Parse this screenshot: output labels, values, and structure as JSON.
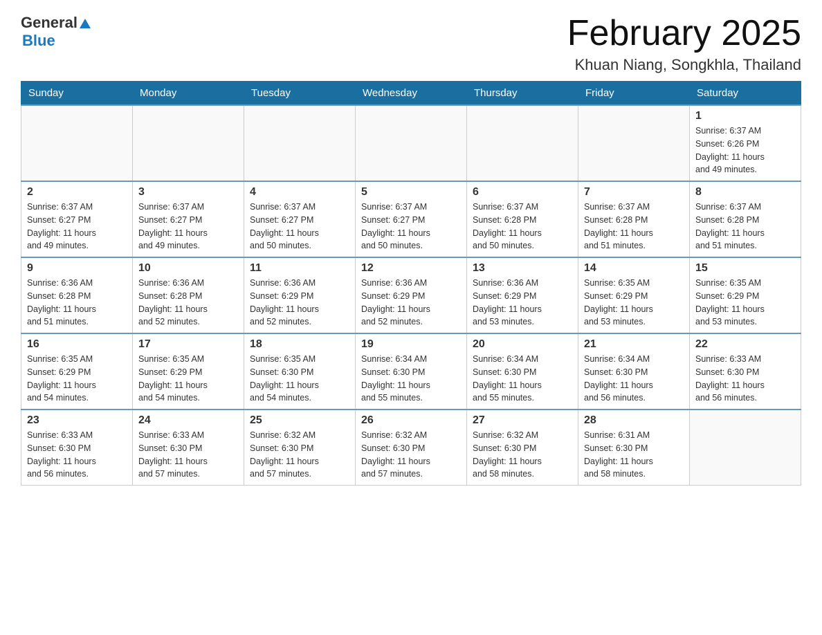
{
  "header": {
    "logo": {
      "general": "General",
      "arrow": "▲",
      "blue": "Blue"
    },
    "title": "February 2025",
    "location": "Khuan Niang, Songkhla, Thailand"
  },
  "calendar": {
    "days_of_week": [
      "Sunday",
      "Monday",
      "Tuesday",
      "Wednesday",
      "Thursday",
      "Friday",
      "Saturday"
    ],
    "weeks": [
      {
        "days": [
          {
            "date": "",
            "info": ""
          },
          {
            "date": "",
            "info": ""
          },
          {
            "date": "",
            "info": ""
          },
          {
            "date": "",
            "info": ""
          },
          {
            "date": "",
            "info": ""
          },
          {
            "date": "",
            "info": ""
          },
          {
            "date": "1",
            "info": "Sunrise: 6:37 AM\nSunset: 6:26 PM\nDaylight: 11 hours\nand 49 minutes."
          }
        ]
      },
      {
        "days": [
          {
            "date": "2",
            "info": "Sunrise: 6:37 AM\nSunset: 6:27 PM\nDaylight: 11 hours\nand 49 minutes."
          },
          {
            "date": "3",
            "info": "Sunrise: 6:37 AM\nSunset: 6:27 PM\nDaylight: 11 hours\nand 49 minutes."
          },
          {
            "date": "4",
            "info": "Sunrise: 6:37 AM\nSunset: 6:27 PM\nDaylight: 11 hours\nand 50 minutes."
          },
          {
            "date": "5",
            "info": "Sunrise: 6:37 AM\nSunset: 6:27 PM\nDaylight: 11 hours\nand 50 minutes."
          },
          {
            "date": "6",
            "info": "Sunrise: 6:37 AM\nSunset: 6:28 PM\nDaylight: 11 hours\nand 50 minutes."
          },
          {
            "date": "7",
            "info": "Sunrise: 6:37 AM\nSunset: 6:28 PM\nDaylight: 11 hours\nand 51 minutes."
          },
          {
            "date": "8",
            "info": "Sunrise: 6:37 AM\nSunset: 6:28 PM\nDaylight: 11 hours\nand 51 minutes."
          }
        ]
      },
      {
        "days": [
          {
            "date": "9",
            "info": "Sunrise: 6:36 AM\nSunset: 6:28 PM\nDaylight: 11 hours\nand 51 minutes."
          },
          {
            "date": "10",
            "info": "Sunrise: 6:36 AM\nSunset: 6:28 PM\nDaylight: 11 hours\nand 52 minutes."
          },
          {
            "date": "11",
            "info": "Sunrise: 6:36 AM\nSunset: 6:29 PM\nDaylight: 11 hours\nand 52 minutes."
          },
          {
            "date": "12",
            "info": "Sunrise: 6:36 AM\nSunset: 6:29 PM\nDaylight: 11 hours\nand 52 minutes."
          },
          {
            "date": "13",
            "info": "Sunrise: 6:36 AM\nSunset: 6:29 PM\nDaylight: 11 hours\nand 53 minutes."
          },
          {
            "date": "14",
            "info": "Sunrise: 6:35 AM\nSunset: 6:29 PM\nDaylight: 11 hours\nand 53 minutes."
          },
          {
            "date": "15",
            "info": "Sunrise: 6:35 AM\nSunset: 6:29 PM\nDaylight: 11 hours\nand 53 minutes."
          }
        ]
      },
      {
        "days": [
          {
            "date": "16",
            "info": "Sunrise: 6:35 AM\nSunset: 6:29 PM\nDaylight: 11 hours\nand 54 minutes."
          },
          {
            "date": "17",
            "info": "Sunrise: 6:35 AM\nSunset: 6:29 PM\nDaylight: 11 hours\nand 54 minutes."
          },
          {
            "date": "18",
            "info": "Sunrise: 6:35 AM\nSunset: 6:30 PM\nDaylight: 11 hours\nand 54 minutes."
          },
          {
            "date": "19",
            "info": "Sunrise: 6:34 AM\nSunset: 6:30 PM\nDaylight: 11 hours\nand 55 minutes."
          },
          {
            "date": "20",
            "info": "Sunrise: 6:34 AM\nSunset: 6:30 PM\nDaylight: 11 hours\nand 55 minutes."
          },
          {
            "date": "21",
            "info": "Sunrise: 6:34 AM\nSunset: 6:30 PM\nDaylight: 11 hours\nand 56 minutes."
          },
          {
            "date": "22",
            "info": "Sunrise: 6:33 AM\nSunset: 6:30 PM\nDaylight: 11 hours\nand 56 minutes."
          }
        ]
      },
      {
        "days": [
          {
            "date": "23",
            "info": "Sunrise: 6:33 AM\nSunset: 6:30 PM\nDaylight: 11 hours\nand 56 minutes."
          },
          {
            "date": "24",
            "info": "Sunrise: 6:33 AM\nSunset: 6:30 PM\nDaylight: 11 hours\nand 57 minutes."
          },
          {
            "date": "25",
            "info": "Sunrise: 6:32 AM\nSunset: 6:30 PM\nDaylight: 11 hours\nand 57 minutes."
          },
          {
            "date": "26",
            "info": "Sunrise: 6:32 AM\nSunset: 6:30 PM\nDaylight: 11 hours\nand 57 minutes."
          },
          {
            "date": "27",
            "info": "Sunrise: 6:32 AM\nSunset: 6:30 PM\nDaylight: 11 hours\nand 58 minutes."
          },
          {
            "date": "28",
            "info": "Sunrise: 6:31 AM\nSunset: 6:30 PM\nDaylight: 11 hours\nand 58 minutes."
          },
          {
            "date": "",
            "info": ""
          }
        ]
      }
    ]
  }
}
